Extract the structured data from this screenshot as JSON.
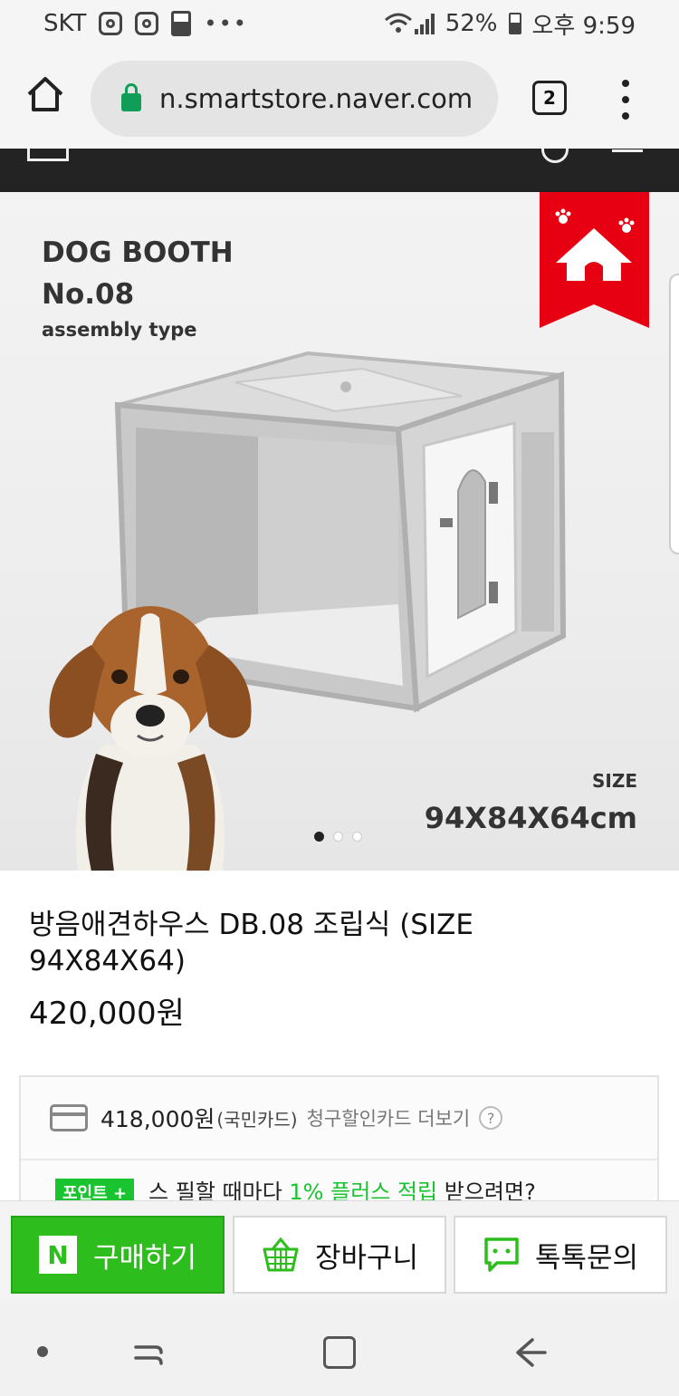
{
  "status_bar": {
    "carrier": "SKT",
    "battery": "52%",
    "time": "오후 9:59"
  },
  "browser": {
    "url": "n.smartstore.naver.com",
    "tab_count": "2"
  },
  "product_image": {
    "title_line1": "DOG BOOTH",
    "title_line2": "No.08",
    "subtitle": "assembly type",
    "size_label": "SIZE",
    "size_value": "94X84X64cm",
    "carousel_total": 3,
    "carousel_active": 1
  },
  "product": {
    "title": "방음애견하우스 DB.08 조립식 (SIZE 94X84X64)",
    "price": "420,000원",
    "card_price": "418,000원",
    "card_name": "(국민카드)",
    "card_more": "청구할인카드 더보기",
    "help": "?",
    "point_badge": "포인트 +",
    "point_text_pre": "스 필할 때마다 ",
    "point_text_highlight": "1% 플러스 적립",
    "point_text_post": " 받으려면?"
  },
  "actions": {
    "buy_logo": "N",
    "buy_label": "구매하기",
    "cart_label": "장바구니",
    "talk_label": "톡톡문의"
  },
  "colors": {
    "naver_green": "#2dbd1c",
    "badge_red": "#e60012",
    "header_dark": "#232323"
  }
}
